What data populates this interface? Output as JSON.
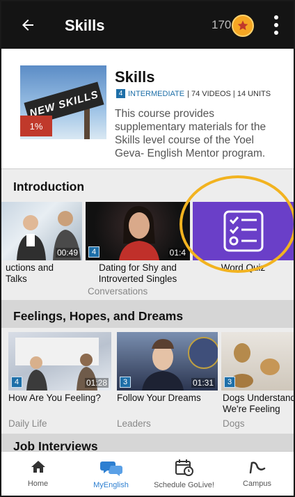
{
  "topbar": {
    "title": "Skills",
    "points": "170"
  },
  "course": {
    "title": "Skills",
    "level_number": "4",
    "level": "INTERMEDIATE",
    "stats": " | 74 VIDEOS | 14 UNITS",
    "description": "This course provides supplementary materials for the Skills level course of the Yoel Geva- English Mentor program.",
    "progress": "1%",
    "thumb_sign_text": "NEW SKILLS"
  },
  "sections": {
    "intro": {
      "title": "Introduction",
      "cards": [
        {
          "title": "uctions and\nTalks",
          "duration": "00:49",
          "sub": ""
        },
        {
          "title": "Dating for Shy and\nIntroverted Singles",
          "duration": "01:4",
          "level": "4",
          "sub": "Conversations"
        },
        {
          "title": "Word Quiz",
          "sub": ""
        }
      ]
    },
    "feelings": {
      "title": "Feelings, Hopes, and Dreams",
      "cards": [
        {
          "title": "How Are You Feeling?",
          "duration": "01:28",
          "level": "4",
          "sub": "Daily Life"
        },
        {
          "title": "Follow Your Dreams",
          "duration": "01:31",
          "level": "3",
          "sub": "Leaders"
        },
        {
          "title": "Dogs Understand\nWe're Feeling",
          "level": "3",
          "sub": "Dogs"
        }
      ]
    },
    "job": {
      "title": "Job Interviews"
    }
  },
  "nav": {
    "items": [
      {
        "label": "Home",
        "icon": "home-icon"
      },
      {
        "label": "MyEnglish",
        "icon": "chat-bubbles-icon",
        "active": true
      },
      {
        "label": "Schedule GoLive!",
        "icon": "calendar-clock-icon"
      },
      {
        "label": "Campus",
        "icon": "campus-icon"
      }
    ]
  },
  "colors": {
    "topbar": "#141414",
    "accent": "#2d7fd1",
    "quiz_purple": "#6a3fc8",
    "highlight": "#f2b320",
    "progress": "#c0392b"
  }
}
